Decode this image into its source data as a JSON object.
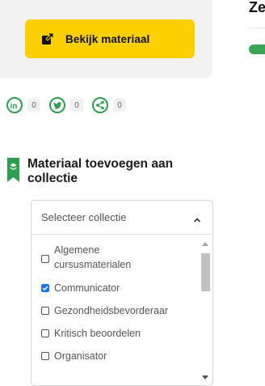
{
  "material_card": {
    "button_label": "Bekijk materiaal",
    "icon": "external-link-icon"
  },
  "right_panel": {
    "title_fragment": "Ze"
  },
  "share": {
    "items": [
      {
        "icon": "linkedin-icon",
        "count": "0"
      },
      {
        "icon": "twitter-icon",
        "count": "0"
      },
      {
        "icon": "share-icon",
        "count": "0"
      }
    ],
    "accent": "#2e9e4f"
  },
  "collection": {
    "heading": "Materiaal toevoegen aan collectie",
    "select_placeholder": "Selecteer collectie",
    "options": [
      {
        "label": "Algemene cursusmaterialen",
        "checked": false
      },
      {
        "label": "Communicator",
        "checked": true
      },
      {
        "label": "Gezondheidsbevorderaar",
        "checked": false
      },
      {
        "label": "Kritisch beoordelen",
        "checked": false
      },
      {
        "label": "Organisator",
        "checked": false
      }
    ]
  },
  "colors": {
    "button": "#fccf00",
    "checkbox_checked": "#1a73e8",
    "bookmark": "#2e9e4f"
  }
}
